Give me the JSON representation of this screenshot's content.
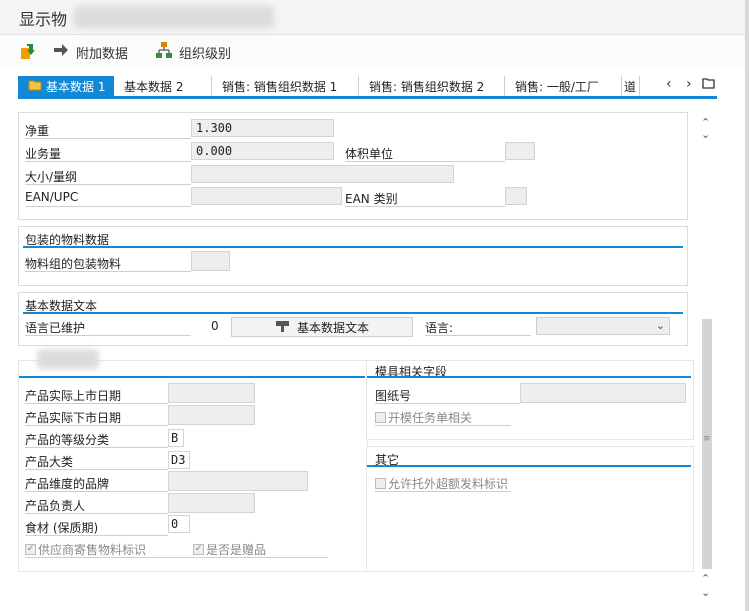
{
  "window": {
    "title_prefix": "显示物"
  },
  "toolbar": {
    "additional_data": "附加数据",
    "org_levels": "组织级别"
  },
  "tabs": [
    "基本数据 1",
    "基本数据 2",
    "销售: 销售组织数据 1",
    "销售: 销售组织数据 2",
    "销售: 一般/工厂",
    "道"
  ],
  "dims": {
    "net_weight_label": "净重",
    "net_weight_value": "1.300",
    "volume_label": "业务量",
    "volume_value": "0.000",
    "volume_unit_label": "体积单位",
    "size_label": "大小/量纲",
    "ean_label": "EAN/UPC",
    "ean_cat_label": "EAN 类别"
  },
  "packaging": {
    "title": "包装的物料数据",
    "group_label": "物料组的包装物料"
  },
  "basic_text": {
    "title": "基本数据文本",
    "lang_maintained_label": "语言已维护",
    "lang_count": "0",
    "button_label": "基本数据文本",
    "language_label": "语言:"
  },
  "product": {
    "launch_date_label": "产品实际上市日期",
    "delist_date_label": "产品实际下市日期",
    "grade_label": "产品的等级分类",
    "grade_value": "B",
    "category_label": "产品大类",
    "category_value": "D3",
    "brand_label": "产品维度的品牌",
    "owner_label": "产品负责人",
    "shelf_label": "食材 (保质期)",
    "shelf_value": "0",
    "consign_label": "供应商寄售物料标识",
    "consign_checked": true,
    "gift_label": "是否是赠品",
    "gift_checked": true
  },
  "mold": {
    "title": "模具相关字段",
    "drawing_label": "图纸号",
    "mold_task_label": "开模任务单相关"
  },
  "other": {
    "title": "其它",
    "overdelivery_label": "允许托外超额发料标识"
  },
  "colors": {
    "accent": "#1189d6"
  }
}
